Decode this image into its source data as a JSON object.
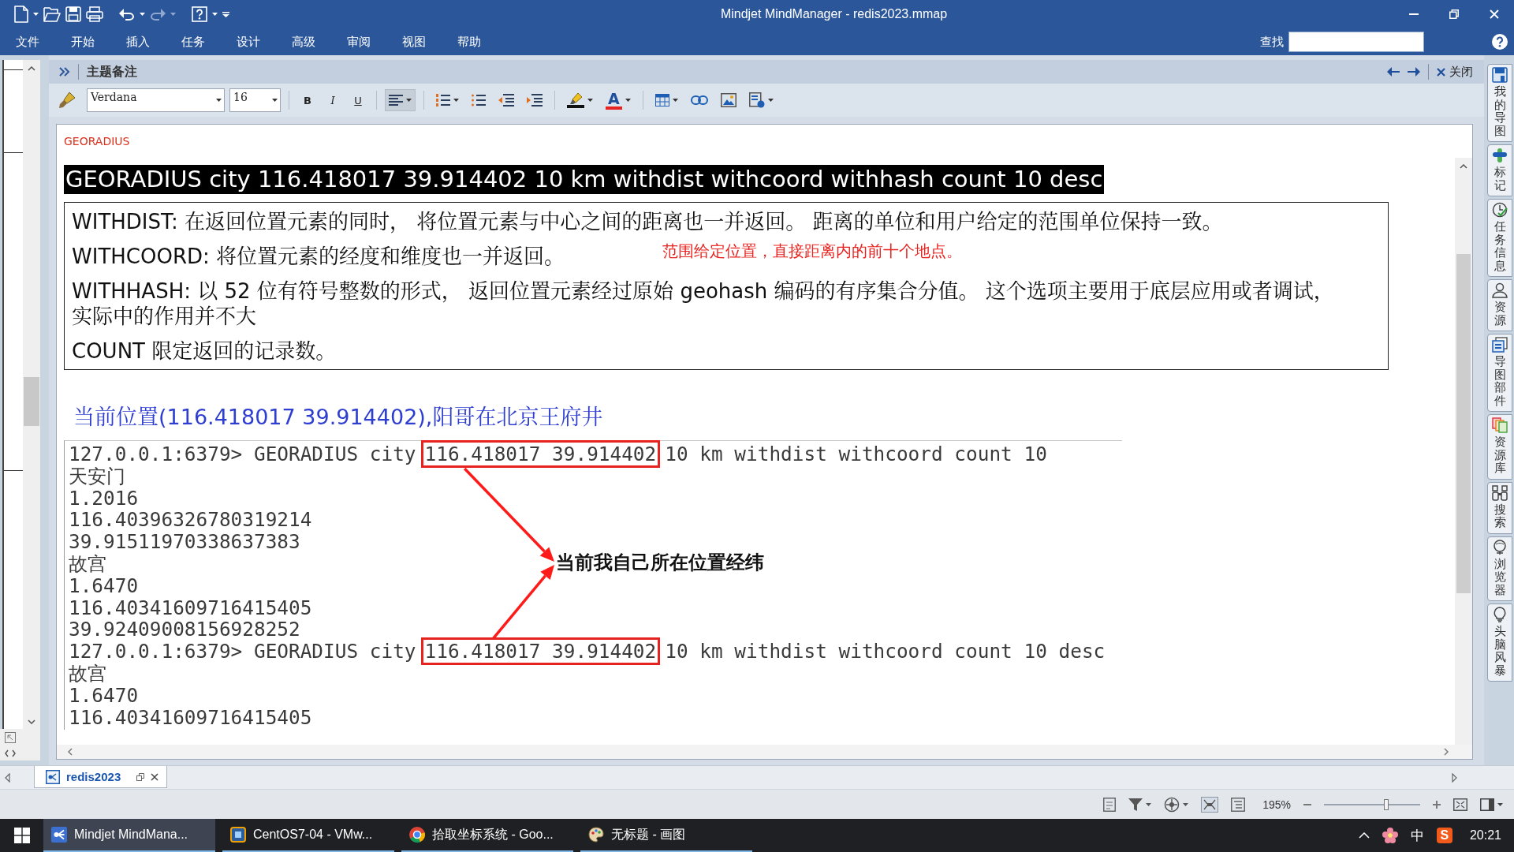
{
  "window": {
    "title": "Mindjet MindManager - redis2023.mmap"
  },
  "menu": {
    "items": [
      "文件",
      "开始",
      "插入",
      "任务",
      "设计",
      "高级",
      "审阅",
      "视图",
      "帮助"
    ],
    "find_label": "查找"
  },
  "notes_panel": {
    "title": "主题备注",
    "close_label": "关闭",
    "toolbar": [
      {
        "kind": "brush"
      },
      {
        "kind": "font",
        "value": "Verdana"
      },
      {
        "kind": "size",
        "value": "16"
      },
      {
        "kind": "bold",
        "label": "B",
        "pressed": false
      },
      {
        "kind": "italic",
        "label": "I",
        "pressed": false
      },
      {
        "kind": "underline",
        "label": "U",
        "pressed": false
      },
      {
        "kind": "align",
        "pressed": true
      },
      {
        "kind": "numbered-list",
        "pressed": false
      },
      {
        "kind": "bullet-list",
        "pressed": false
      },
      {
        "kind": "outdent"
      },
      {
        "kind": "indent"
      },
      {
        "kind": "highlight"
      },
      {
        "kind": "font-color",
        "label": "A"
      },
      {
        "kind": "table"
      },
      {
        "kind": "link"
      },
      {
        "kind": "image"
      },
      {
        "kind": "insert"
      }
    ]
  },
  "note": {
    "topic": "GEORADIUS",
    "command": "GEORADIUS city 116.418017 39.914402 10 km withdist withcoord withhash count 10 desc",
    "options": [
      {
        "term": "WITHDIST:",
        "text": "在返回位置元素的同时， 将位置元素与中心之间的距离也一并返回。 距离的单位和用户给定的范围单位保持一致。"
      },
      {
        "term": "WITHCOORD:",
        "text": "将位置元素的经度和维度也一并返回。"
      },
      {
        "term": "WITHHASH:",
        "text": "以 52 位有符号整数的形式， 返回位置元素经过原始 geohash 编码的有序集合分值。 这个选项主要用于底层应用或者调试，实际中的作用并不大"
      },
      {
        "term": "COUNT",
        "text": "限定返回的记录数。"
      }
    ],
    "annotation": "范围给定位置，直接距离内的前十个地点。",
    "location": "当前位置(116.418017 39.914402),阳哥在北京王府井",
    "terminal": {
      "lines": [
        {
          "kind": "command",
          "text": "127.0.0.1:6379> GEORADIUS city",
          "coords": "116.418017 39.914402",
          "rest": "10 km withdist withcoord count 10"
        },
        {
          "kind": "output",
          "text": "天安门"
        },
        {
          "kind": "output",
          "text": "1.2016"
        },
        {
          "kind": "output",
          "text": "116.40396326780319214"
        },
        {
          "kind": "output",
          "text": "39.91511970338637383"
        },
        {
          "kind": "output",
          "text": "故宫"
        },
        {
          "kind": "output",
          "text": "1.6470"
        },
        {
          "kind": "output",
          "text": "116.40341609716415405"
        },
        {
          "kind": "output",
          "text": "39.92409008156928252"
        },
        {
          "kind": "command",
          "text": "127.0.0.1:6379> GEORADIUS city",
          "coords": "116.418017 39.914402",
          "rest": "10 km withdist withcoord count 10 desc"
        },
        {
          "kind": "output",
          "text": "故宫"
        },
        {
          "kind": "output",
          "text": "1.6470"
        },
        {
          "kind": "output",
          "text": "116.40341609716415405"
        }
      ],
      "callout": "当前我自己所在位置经纬"
    }
  },
  "side_tabs": [
    {
      "kind": "maps",
      "label": "我的导图"
    },
    {
      "kind": "markers",
      "label": "标记"
    },
    {
      "kind": "task",
      "label": "任务信息"
    },
    {
      "kind": "resources",
      "label": "资源"
    },
    {
      "kind": "parts",
      "label": "导图部件"
    },
    {
      "kind": "library",
      "label": "资源库"
    },
    {
      "kind": "search",
      "label": "搜索"
    },
    {
      "kind": "browser",
      "label": "浏览器"
    },
    {
      "kind": "brainstorm",
      "label": "头脑风暴"
    }
  ],
  "doc_tabs": [
    {
      "label": "redis2023",
      "selected": true
    }
  ],
  "status_bar": {
    "zoom": "195%",
    "zoom_slider": {
      "level": 0.65
    }
  },
  "taskbar": {
    "apps": [
      {
        "kind": "map-app",
        "label": "Mindjet MindMana...",
        "selected": true
      },
      {
        "kind": "vm-app",
        "label": "CentOS7-04 - VMw...",
        "selected": false
      },
      {
        "kind": "browser",
        "label": "拾取坐标系统 - Goo...",
        "selected": false
      },
      {
        "kind": "paint",
        "label": "无标题 - 画图",
        "selected": false
      }
    ],
    "ime": "中",
    "tray_logo": "S",
    "time": "20:21"
  }
}
